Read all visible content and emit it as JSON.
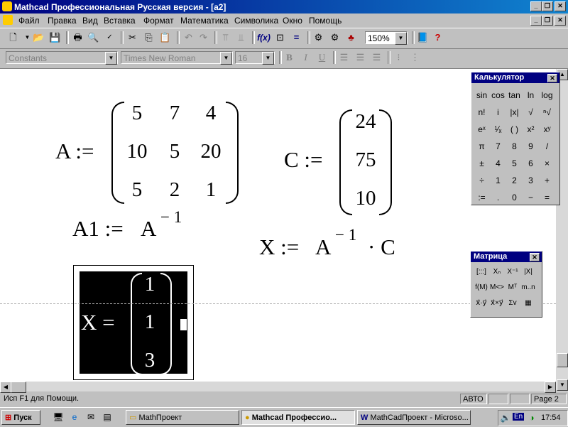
{
  "window": {
    "title": "Mathcad Профессиональная Русская версия - [a2]"
  },
  "menu": [
    "Файл",
    "Правка",
    "Вид",
    "Вставка",
    "Формат",
    "Математика",
    "Символика",
    "Окно",
    "Помощь"
  ],
  "format_bar": {
    "style": "Constants",
    "font": "Times New Roman",
    "size": "16"
  },
  "toolbar": {
    "zoom": "150%"
  },
  "worksheet": {
    "a_label": "A :=",
    "matrix_a": [
      "5",
      "7",
      "4",
      "10",
      "5",
      "20",
      "5",
      "2",
      "1"
    ],
    "c_label": "C :=",
    "matrix_c": [
      "24",
      "75",
      "10"
    ],
    "a1_label": "A1 :=",
    "a_inv_base": "A",
    "a_inv_exp": "− 1",
    "x_def_label": "X :=",
    "x_def_a": "A",
    "x_def_exp": "− 1",
    "x_def_rest": "· C",
    "x_result_label": "X =",
    "x_result": [
      "1",
      "1",
      "3"
    ]
  },
  "calculator_palette": {
    "title": "Калькулятор",
    "buttons": [
      "sin",
      "cos",
      "tan",
      "ln",
      "log",
      "n!",
      "i",
      "|x|",
      "√",
      "ⁿ√",
      "eˣ",
      "¹⁄ₓ",
      "( )",
      "x²",
      "xʸ",
      "π",
      "7",
      "8",
      "9",
      "/",
      "±",
      "4",
      "5",
      "6",
      "×",
      "÷",
      "1",
      "2",
      "3",
      "+",
      ":=",
      ".",
      "0",
      "−",
      "="
    ]
  },
  "matrix_palette": {
    "title": "Матрица",
    "buttons": [
      "[:::]",
      "Xₙ",
      "X⁻¹",
      "|X|",
      "f(M)",
      "M<>",
      "Mᵀ",
      "m..n",
      "x⃗·y⃗",
      "x⃗×y⃗",
      "Σv",
      "▦"
    ]
  },
  "statusbar": {
    "hint": "Исп F1 для Помощи.",
    "mode": "АВТО",
    "page": "Page 2"
  },
  "taskbar": {
    "start": "Пуск",
    "tasks": [
      "MathПроект",
      "Mathcad Профессио...",
      "MathCadПроект - Microso..."
    ],
    "tray_lang": "En",
    "clock": "17:54"
  }
}
